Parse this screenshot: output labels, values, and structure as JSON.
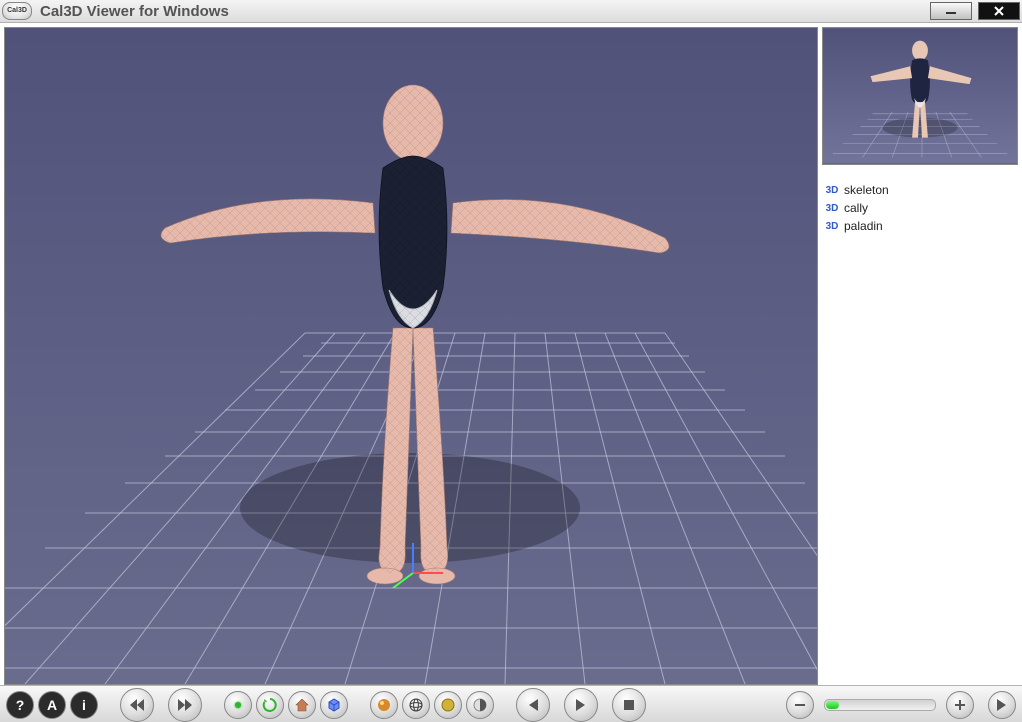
{
  "window": {
    "app_icon_text": "Cal3D",
    "title": "Cal3D Viewer for Windows"
  },
  "sidebar": {
    "models": [
      {
        "icon": "3D",
        "label": "skeleton"
      },
      {
        "icon": "3D",
        "label": "cally"
      },
      {
        "icon": "3D",
        "label": "paladin"
      }
    ]
  },
  "toolbar": {
    "help_label": "?",
    "text_label": "A",
    "info_label": "i"
  },
  "slider": {
    "value_percent": 12
  }
}
